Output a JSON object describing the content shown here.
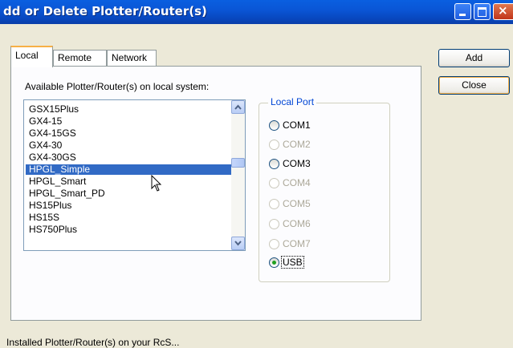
{
  "window": {
    "title": "dd or Delete Plotter/Router(s)",
    "close_glyph": "×"
  },
  "tabs": [
    {
      "label": "Local",
      "active": true
    },
    {
      "label": "Remote",
      "active": false
    },
    {
      "label": "Network",
      "active": false
    }
  ],
  "available_label": "Available Plotter/Router(s) on local system:",
  "plotters": [
    {
      "name": "GSX15Plus",
      "selected": false
    },
    {
      "name": "GX4-15",
      "selected": false
    },
    {
      "name": "GX4-15GS",
      "selected": false
    },
    {
      "name": "GX4-30",
      "selected": false
    },
    {
      "name": "GX4-30GS",
      "selected": false
    },
    {
      "name": "HPGL_Simple",
      "selected": true
    },
    {
      "name": "HPGL_Smart",
      "selected": false
    },
    {
      "name": "HPGL_Smart_PD",
      "selected": false
    },
    {
      "name": "HS15Plus",
      "selected": false
    },
    {
      "name": "HS15S",
      "selected": false
    },
    {
      "name": "HS750Plus",
      "selected": false
    }
  ],
  "local_port": {
    "label": "Local Port",
    "ports": [
      {
        "label": "COM1",
        "enabled": true,
        "checked": false
      },
      {
        "label": "COM2",
        "enabled": false,
        "checked": false
      },
      {
        "label": "COM3",
        "enabled": true,
        "checked": false
      },
      {
        "label": "COM4",
        "enabled": false,
        "checked": false
      },
      {
        "label": "COM5",
        "enabled": false,
        "checked": false
      },
      {
        "label": "COM6",
        "enabled": false,
        "checked": false
      },
      {
        "label": "COM7",
        "enabled": false,
        "checked": false
      },
      {
        "label": "USB",
        "enabled": true,
        "checked": true
      }
    ]
  },
  "buttons": {
    "add": "Add",
    "close": "Close"
  },
  "bottom_partial_text": "Installed Plotter/Router(s) on your RcS..."
}
